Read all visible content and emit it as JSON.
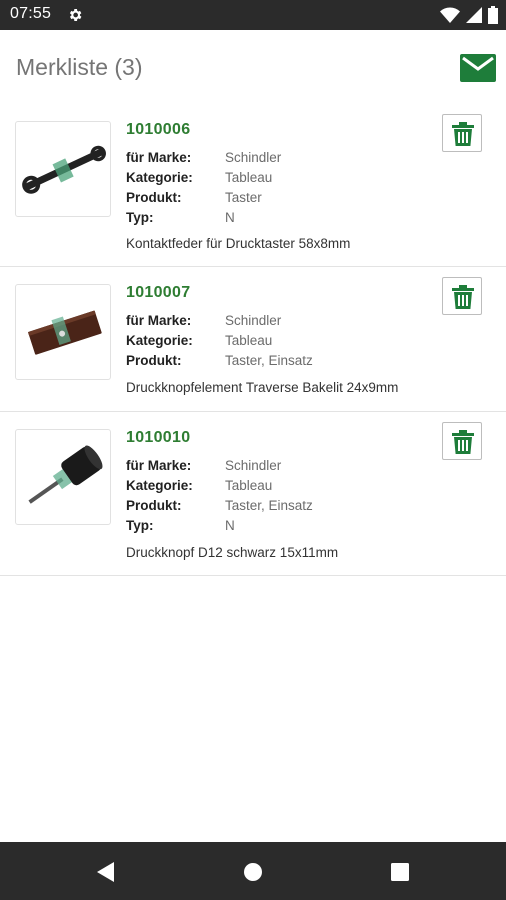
{
  "status_bar": {
    "time": "07:55",
    "icons": [
      "gear-icon",
      "wifi-icon",
      "signal-icon",
      "battery-icon"
    ]
  },
  "header": {
    "title": "Merkliste (3)",
    "mail_icon": "mail-icon"
  },
  "colors": {
    "brand_green": "#1e7d3a",
    "article_green": "#2e7d32",
    "status_bar": "#2b2b2b",
    "nav_bar": "#2b2b2b"
  },
  "items": [
    {
      "article_number": "1010006",
      "attributes": [
        {
          "label": "für Marke:",
          "value": "Schindler"
        },
        {
          "label": "Kategorie:",
          "value": "Tableau"
        },
        {
          "label": "Produkt:",
          "value": "Taster"
        },
        {
          "label": "Typ:",
          "value": "N"
        }
      ],
      "description": "Kontaktfeder für Drucktaster 58x8mm",
      "delete_icon": "trash-icon"
    },
    {
      "article_number": "1010007",
      "attributes": [
        {
          "label": "für Marke:",
          "value": "Schindler"
        },
        {
          "label": "Kategorie:",
          "value": "Tableau"
        },
        {
          "label": "Produkt:",
          "value": "Taster, Einsatz"
        }
      ],
      "description": "Druckknopfelement Traverse Bakelit 24x9mm",
      "delete_icon": "trash-icon"
    },
    {
      "article_number": "1010010",
      "attributes": [
        {
          "label": "für Marke:",
          "value": "Schindler"
        },
        {
          "label": "Kategorie:",
          "value": "Tableau"
        },
        {
          "label": "Produkt:",
          "value": "Taster, Einsatz"
        },
        {
          "label": "Typ:",
          "value": "N"
        }
      ],
      "description": "Druckknopf D12 schwarz 15x11mm",
      "delete_icon": "trash-icon"
    }
  ],
  "nav_bar": {
    "buttons": [
      "back-icon",
      "home-icon",
      "recents-icon"
    ]
  }
}
